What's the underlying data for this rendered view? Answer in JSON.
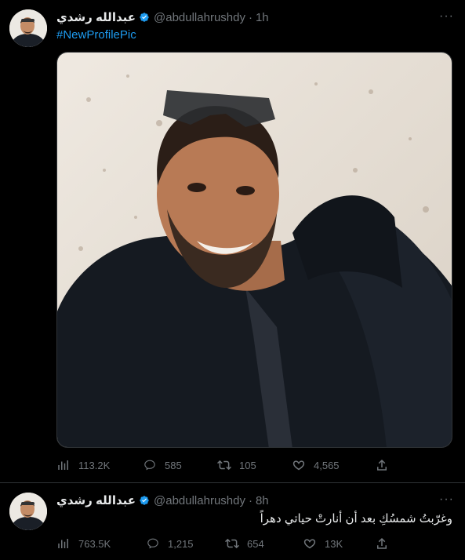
{
  "tweets": [
    {
      "author": {
        "name": "عبدالله رشدي",
        "handle": "@abdullahrushdy",
        "time": "1h"
      },
      "text": "#NewProfilePic",
      "stats": {
        "views": "113.2K",
        "replies": "585",
        "retweets": "105",
        "likes": "4,565"
      }
    },
    {
      "author": {
        "name": "عبدالله رشدي",
        "handle": "@abdullahrushdy",
        "time": "8h"
      },
      "text": "وغرّبتُ شمسُكِ بعد أن أنارتْ حياتي دهراً",
      "stats": {
        "views": "763.5K",
        "replies": "1,215",
        "retweets": "654",
        "likes": "13K"
      }
    }
  ],
  "ui": {
    "separator": "·",
    "more": "···"
  },
  "colors": {
    "background": "#000000",
    "accent": "#1d9bf0",
    "muted": "#71767b",
    "divider": "#2f3336"
  }
}
